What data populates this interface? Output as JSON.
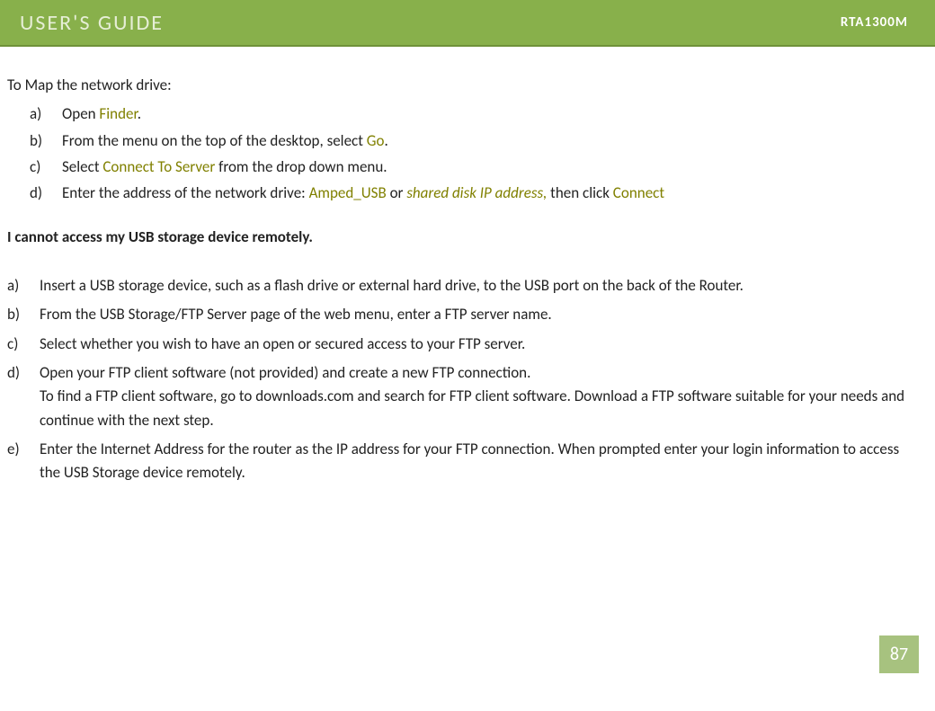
{
  "header": {
    "title": "USER'S GUIDE",
    "model": "RTA1300M"
  },
  "intro": "To Map the network drive:",
  "steps1": {
    "a": {
      "m": "a)",
      "t1": "Open ",
      "l1": "Finder",
      "t2": "."
    },
    "b": {
      "m": "b)",
      "t1": "From the menu on the top of the desktop, select ",
      "l1": "Go",
      "t2": "."
    },
    "c": {
      "m": "c)",
      "t1": "Select ",
      "l1": "Connect To Server",
      "t2": " from the drop down menu."
    },
    "d": {
      "m": "d)",
      "t1": "Enter the address of the network drive: ",
      "l1": "Amped_USB",
      "t2": "    or  ",
      "l2": "shared disk IP address,",
      "t3": "  then click ",
      "l3": "Connect"
    }
  },
  "question": "I cannot access my USB storage device remotely.",
  "steps2": {
    "a": {
      "m": "a)",
      "t": "Insert a USB storage device, such as a flash drive or external hard drive, to the USB port on the back of the Router."
    },
    "b": {
      "m": "b)",
      "t": "From the USB Storage/FTP Server page of the web menu, enter a FTP server name."
    },
    "c": {
      "m": "c)",
      "t": "Select whether you wish to have an open or secured access to your FTP server."
    },
    "d": {
      "m": "d)",
      "t": "Open your FTP client software (not provided) and create a new FTP connection.\nTo find a FTP client software, go to downloads.com and search for FTP client software.  Download a FTP software suitable for your needs and continue with the next step."
    },
    "e": {
      "m": "e)",
      "t": "Enter the Internet Address for the router as the IP address for your FTP connection.  When prompted enter your login information to access the USB Storage device remotely."
    }
  },
  "page_number": "87"
}
